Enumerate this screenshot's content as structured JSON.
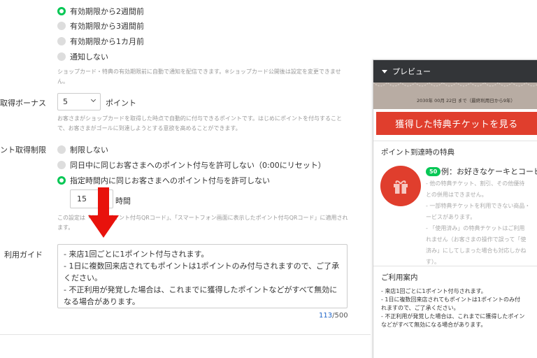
{
  "notify": {
    "options": [
      {
        "label": "有効期限から2週間前",
        "selected": true
      },
      {
        "label": "有効期限から3週間前",
        "selected": false
      },
      {
        "label": "有効期限から1カ月前",
        "selected": false
      },
      {
        "label": "通知しない",
        "selected": false
      }
    ],
    "note": "ショップカード・特典の有効期限前に自動で通知を配信できます。※ショップカード公開後は設定を変更できません。"
  },
  "bonus": {
    "label": "取得ボーナス",
    "value": "5",
    "unit": "ポイント",
    "note": "お客さまがショップカードを取得した時点で自動的に付与できるポイントです。はじめにポイントを付与することで、お客さまがゴールに到達しようとする意欲を高めることができます。"
  },
  "limit": {
    "label": "ント取得制限",
    "options": [
      {
        "label": "制限しない",
        "selected": false
      },
      {
        "label": "同日中に同じお客さまへのポイント付与を許可しない（0:00にリセット）",
        "selected": false
      },
      {
        "label": "指定時間内に同じお客さまへのポイント付与を許可しない",
        "selected": true
      }
    ],
    "hours_value": "15",
    "hours_unit": "時間",
    "note": "この設定は「印刷用ポイント付与QRコード」、「スマートフォン画面に表示したポイント付与QRコード」に適用されます。"
  },
  "guide": {
    "label": "利用ガイド",
    "lines": [
      "- 来店1回ごとに1ポイント付与されます。",
      "- 1日に複数回来店されてもポイントは1ポイントのみ付与されますので、ご了承ください。",
      "- 不正利用が発覚した場合は、これまでに獲得したポイントなどがすべて無効になる場合があります。"
    ],
    "count": "113",
    "max": "/500"
  },
  "preview": {
    "header": "プレビュー",
    "expiry": "2030年 00月 22日 まで（最終利用日から9年）",
    "button": "獲得した特典チケットを見る",
    "perk_section": "ポイント到達時の特典",
    "perk_points": "50",
    "perk_title": "例：お好きなケーキとコーヒ",
    "perk_notes": [
      "- 他の特典チケット、割引、その他優待",
      "との併用はできません。",
      "- 一部特典チケットを利用できない商品・",
      "ービスがあります。",
      "- 「使用済み」の特典チケットはご利用",
      "れません（お客さまの操作で誤って「使",
      "済み」にしてしまった場合も対応しかね",
      "す）。"
    ],
    "guide_title": "ご利用案内",
    "guide_lines": [
      "- 来店1回ごとに1ポイント付与されます。",
      "- 1日に複数回来店されてもポイントは1ポイントのみ付",
      "れますので、ご了承ください。",
      "- 不正利用が発覚した場合は、これまでに獲得したポイン",
      "などがすべて無効になる場合があります。"
    ]
  },
  "colors": {
    "accent_green": "#06c755",
    "arrow_red": "#e8120c",
    "ticket_red": "#e03e2d"
  }
}
